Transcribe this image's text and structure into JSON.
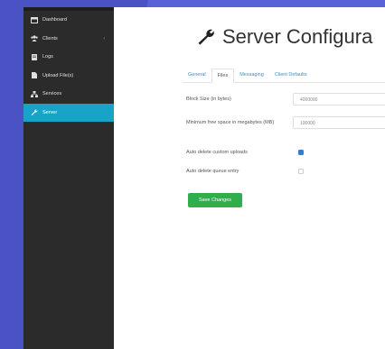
{
  "sidebar": {
    "items": [
      {
        "label": "Dashboard",
        "icon": "dashboard-icon"
      },
      {
        "label": "Clients",
        "icon": "users-icon",
        "chevron": "‹"
      },
      {
        "label": "Logs",
        "icon": "logs-icon"
      },
      {
        "label": "Upload File(s)",
        "icon": "upload-icon"
      },
      {
        "label": "Services",
        "icon": "services-icon"
      },
      {
        "label": "Server",
        "icon": "wrench-icon"
      }
    ]
  },
  "header": {
    "title": "Server Configura"
  },
  "tabs": [
    {
      "label": "General"
    },
    {
      "label": "Files"
    },
    {
      "label": "Messaging"
    },
    {
      "label": "Client Defaults"
    }
  ],
  "form": {
    "block_size": {
      "label": "Block Size (in bytes)",
      "value": "4000000"
    },
    "min_free": {
      "label": "Minimum free space in megabytes (MB)",
      "value": "100000"
    },
    "auto_delete_uploads": {
      "label": "Auto delete custom uploads",
      "checked": true
    },
    "auto_delete_queue": {
      "label": "Auto delete queue entry",
      "checked": false
    }
  },
  "save_button": "Save Changes",
  "colors": {
    "background": "#4b52c4",
    "sidebar": "#2b2b2b",
    "active": "#1aa3c8",
    "save": "#2fae4e",
    "link": "#3a8fc7"
  }
}
